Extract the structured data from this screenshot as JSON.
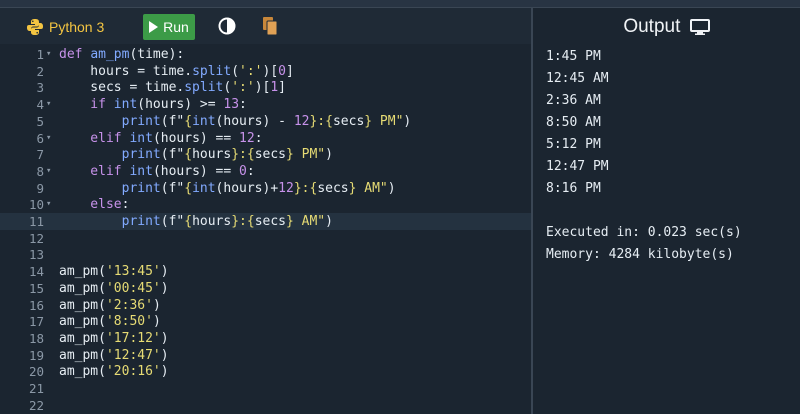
{
  "toolbar": {
    "language": "Python 3",
    "run_label": "Run"
  },
  "editor": {
    "lines": [
      {
        "n": "1",
        "fold": true,
        "html": [
          [
            "kw",
            "def "
          ],
          [
            "fn",
            "am_pm"
          ],
          [
            "txt",
            "(time):"
          ]
        ]
      },
      {
        "n": "2",
        "fold": false,
        "html": [
          [
            "txt",
            "    hours = time."
          ],
          [
            "fn",
            "split"
          ],
          [
            "txt",
            "("
          ],
          [
            "str",
            "':'"
          ],
          [
            "txt",
            ")["
          ],
          [
            "num",
            "0"
          ],
          [
            "txt",
            "]"
          ]
        ]
      },
      {
        "n": "3",
        "fold": false,
        "html": [
          [
            "txt",
            "    secs = time."
          ],
          [
            "fn",
            "split"
          ],
          [
            "txt",
            "("
          ],
          [
            "str",
            "':'"
          ],
          [
            "txt",
            ")["
          ],
          [
            "num",
            "1"
          ],
          [
            "txt",
            "]"
          ]
        ]
      },
      {
        "n": "4",
        "fold": true,
        "html": [
          [
            "kw",
            "    if "
          ],
          [
            "fn",
            "int"
          ],
          [
            "txt",
            "(hours) >= "
          ],
          [
            "num",
            "13"
          ],
          [
            "txt",
            ":"
          ]
        ]
      },
      {
        "n": "5",
        "fold": false,
        "html": [
          [
            "fn",
            "        print"
          ],
          [
            "txt",
            "(f\""
          ],
          [
            "str",
            "{"
          ],
          [
            "fn",
            "int"
          ],
          [
            "txt",
            "(hours) - "
          ],
          [
            "num",
            "12"
          ],
          [
            "str",
            "}:{"
          ],
          [
            "txt",
            "secs"
          ],
          [
            "str",
            "} PM\""
          ],
          [
            "txt",
            ")"
          ]
        ]
      },
      {
        "n": "6",
        "fold": true,
        "html": [
          [
            "kw",
            "    elif "
          ],
          [
            "fn",
            "int"
          ],
          [
            "txt",
            "(hours) == "
          ],
          [
            "num",
            "12"
          ],
          [
            "txt",
            ":"
          ]
        ]
      },
      {
        "n": "7",
        "fold": false,
        "html": [
          [
            "fn",
            "        print"
          ],
          [
            "txt",
            "(f\""
          ],
          [
            "str",
            "{"
          ],
          [
            "txt",
            "hours"
          ],
          [
            "str",
            "}:{"
          ],
          [
            "txt",
            "secs"
          ],
          [
            "str",
            "} PM\""
          ],
          [
            "txt",
            ")"
          ]
        ]
      },
      {
        "n": "8",
        "fold": true,
        "html": [
          [
            "kw",
            "    elif "
          ],
          [
            "fn",
            "int"
          ],
          [
            "txt",
            "(hours) == "
          ],
          [
            "num",
            "0"
          ],
          [
            "txt",
            ":"
          ]
        ]
      },
      {
        "n": "9",
        "fold": false,
        "html": [
          [
            "fn",
            "        print"
          ],
          [
            "txt",
            "(f\""
          ],
          [
            "str",
            "{"
          ],
          [
            "fn",
            "int"
          ],
          [
            "txt",
            "(hours)+"
          ],
          [
            "num",
            "12"
          ],
          [
            "str",
            "}:{"
          ],
          [
            "txt",
            "secs"
          ],
          [
            "str",
            "} AM\""
          ],
          [
            "txt",
            ")"
          ]
        ]
      },
      {
        "n": "10",
        "fold": true,
        "html": [
          [
            "kw",
            "    else"
          ],
          [
            "txt",
            ":"
          ]
        ]
      },
      {
        "n": "11",
        "fold": false,
        "active": true,
        "html": [
          [
            "fn",
            "        print"
          ],
          [
            "txt",
            "(f\""
          ],
          [
            "str",
            "{"
          ],
          [
            "txt",
            "hours"
          ],
          [
            "str",
            "}:{"
          ],
          [
            "txt",
            "secs"
          ],
          [
            "str",
            "} AM\""
          ],
          [
            "txt",
            ")"
          ]
        ]
      },
      {
        "n": "12",
        "fold": false,
        "html": []
      },
      {
        "n": "13",
        "fold": false,
        "html": []
      },
      {
        "n": "14",
        "fold": false,
        "html": [
          [
            "txt",
            "am_pm("
          ],
          [
            "str",
            "'13:45'"
          ],
          [
            "txt",
            ")"
          ]
        ]
      },
      {
        "n": "15",
        "fold": false,
        "html": [
          [
            "txt",
            "am_pm("
          ],
          [
            "str",
            "'00:45'"
          ],
          [
            "txt",
            ")"
          ]
        ]
      },
      {
        "n": "16",
        "fold": false,
        "html": [
          [
            "txt",
            "am_pm("
          ],
          [
            "str",
            "'2:36'"
          ],
          [
            "txt",
            ")"
          ]
        ]
      },
      {
        "n": "17",
        "fold": false,
        "html": [
          [
            "txt",
            "am_pm("
          ],
          [
            "str",
            "'8:50'"
          ],
          [
            "txt",
            ")"
          ]
        ]
      },
      {
        "n": "18",
        "fold": false,
        "html": [
          [
            "txt",
            "am_pm("
          ],
          [
            "str",
            "'17:12'"
          ],
          [
            "txt",
            ")"
          ]
        ]
      },
      {
        "n": "19",
        "fold": false,
        "html": [
          [
            "txt",
            "am_pm("
          ],
          [
            "str",
            "'12:47'"
          ],
          [
            "txt",
            ")"
          ]
        ]
      },
      {
        "n": "20",
        "fold": false,
        "html": [
          [
            "txt",
            "am_pm("
          ],
          [
            "str",
            "'20:16'"
          ],
          [
            "txt",
            ")"
          ]
        ]
      },
      {
        "n": "21",
        "fold": false,
        "html": []
      },
      {
        "n": "22",
        "fold": false,
        "html": []
      }
    ]
  },
  "output": {
    "title": "Output",
    "lines": [
      "1:45 PM",
      "12:45 AM",
      "2:36 AM",
      "8:50 AM",
      "5:12 PM",
      "12:47 PM",
      "8:16 PM",
      "",
      "Executed in: 0.023 sec(s)",
      "Memory: 4284 kilobyte(s)"
    ]
  },
  "icons": {
    "language": "python-logo-icon",
    "run": "play-icon",
    "theme": "contrast-icon",
    "copy": "copy-icon",
    "output": "monitor-icon"
  }
}
